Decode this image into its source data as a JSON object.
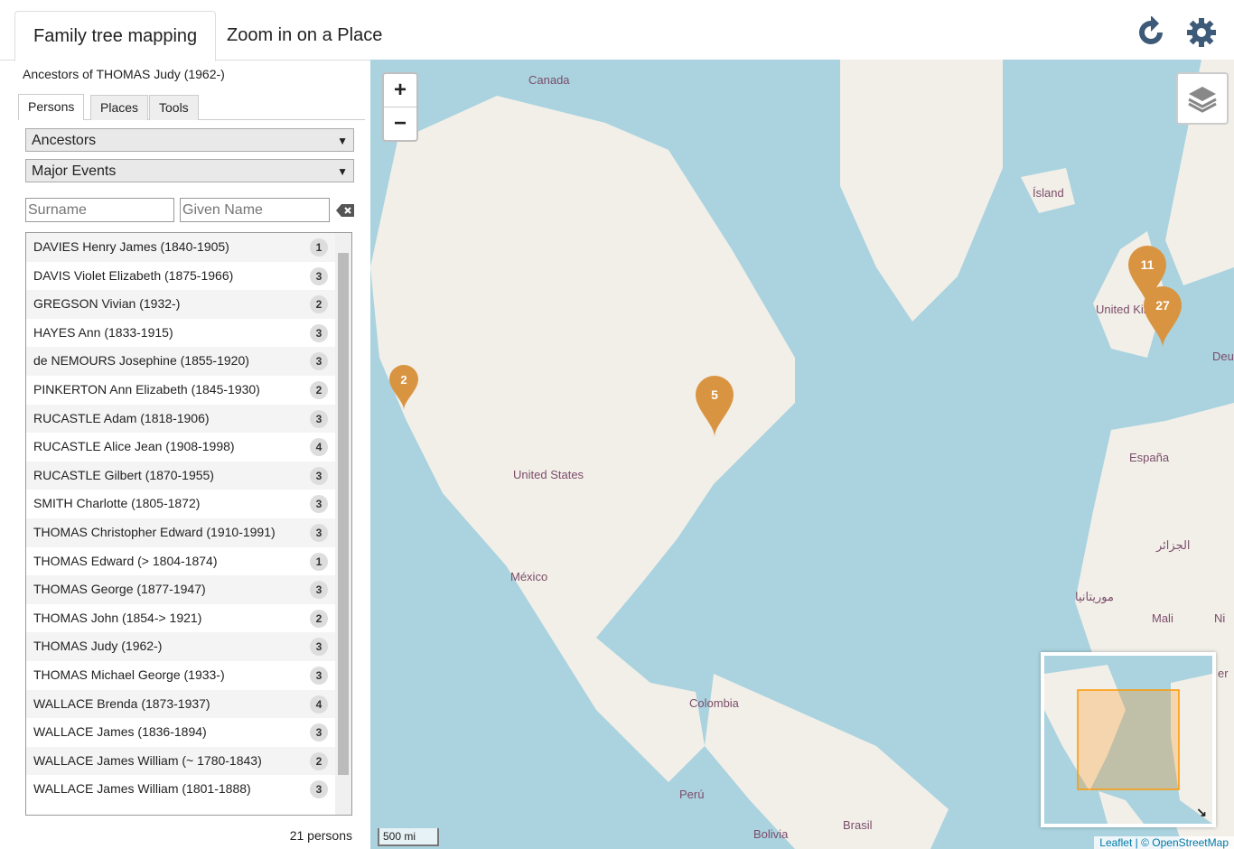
{
  "top_tabs": [
    "Family tree mapping",
    "Zoom in on a Place"
  ],
  "panel": {
    "title": "Ancestors of THOMAS Judy (1962-)",
    "subtabs": [
      "Persons",
      "Places",
      "Tools"
    ],
    "select1": "Ancestors",
    "select2": "Major Events",
    "surname_placeholder": "Surname",
    "given_placeholder": "Given Name",
    "count": "21 persons"
  },
  "persons": [
    {
      "name": "DAVIES Henry James (1840-1905)",
      "n": "1"
    },
    {
      "name": "DAVIS Violet Elizabeth (1875-1966)",
      "n": "3"
    },
    {
      "name": "GREGSON Vivian (1932-)",
      "n": "2"
    },
    {
      "name": "HAYES Ann (1833-1915)",
      "n": "3"
    },
    {
      "name": "de NEMOURS Josephine (1855-1920)",
      "n": "3"
    },
    {
      "name": "PINKERTON Ann Elizabeth (1845-1930)",
      "n": "2"
    },
    {
      "name": "RUCASTLE Adam (1818-1906)",
      "n": "3"
    },
    {
      "name": "RUCASTLE Alice Jean (1908-1998)",
      "n": "4"
    },
    {
      "name": "RUCASTLE Gilbert (1870-1955)",
      "n": "3"
    },
    {
      "name": "SMITH Charlotte (1805-1872)",
      "n": "3"
    },
    {
      "name": "THOMAS Christopher Edward (1910-1991)",
      "n": "3"
    },
    {
      "name": "THOMAS Edward (> 1804-1874)",
      "n": "1"
    },
    {
      "name": "THOMAS George (1877-1947)",
      "n": "3"
    },
    {
      "name": "THOMAS John (1854-> 1921)",
      "n": "2"
    },
    {
      "name": "THOMAS Judy (1962-)",
      "n": "3"
    },
    {
      "name": "THOMAS Michael George (1933-)",
      "n": "3"
    },
    {
      "name": "WALLACE Brenda (1873-1937)",
      "n": "4"
    },
    {
      "name": "WALLACE James (1836-1894)",
      "n": "3"
    },
    {
      "name": "WALLACE James William (~ 1780-1843)",
      "n": "2"
    },
    {
      "name": "WALLACE James William (1801-1888)",
      "n": "3"
    }
  ],
  "map": {
    "zoom_in": "+",
    "zoom_out": "−",
    "labels": [
      "Canada",
      "Ísland",
      "United Kingdom",
      "Deut",
      "United States",
      "España",
      "México",
      "الجزائر",
      "موريتانيا",
      "Mali",
      "Ni",
      "Colombia",
      "Perú",
      "Bolivia",
      "Brasil",
      "er"
    ],
    "markers": [
      "2",
      "5",
      "11",
      "27"
    ],
    "scale": "500 mi",
    "attribution": "Leaflet | © OpenStreetMap"
  },
  "colors": {
    "marker": "#d99442",
    "land": "#f2efe9",
    "water": "#aad3df"
  }
}
